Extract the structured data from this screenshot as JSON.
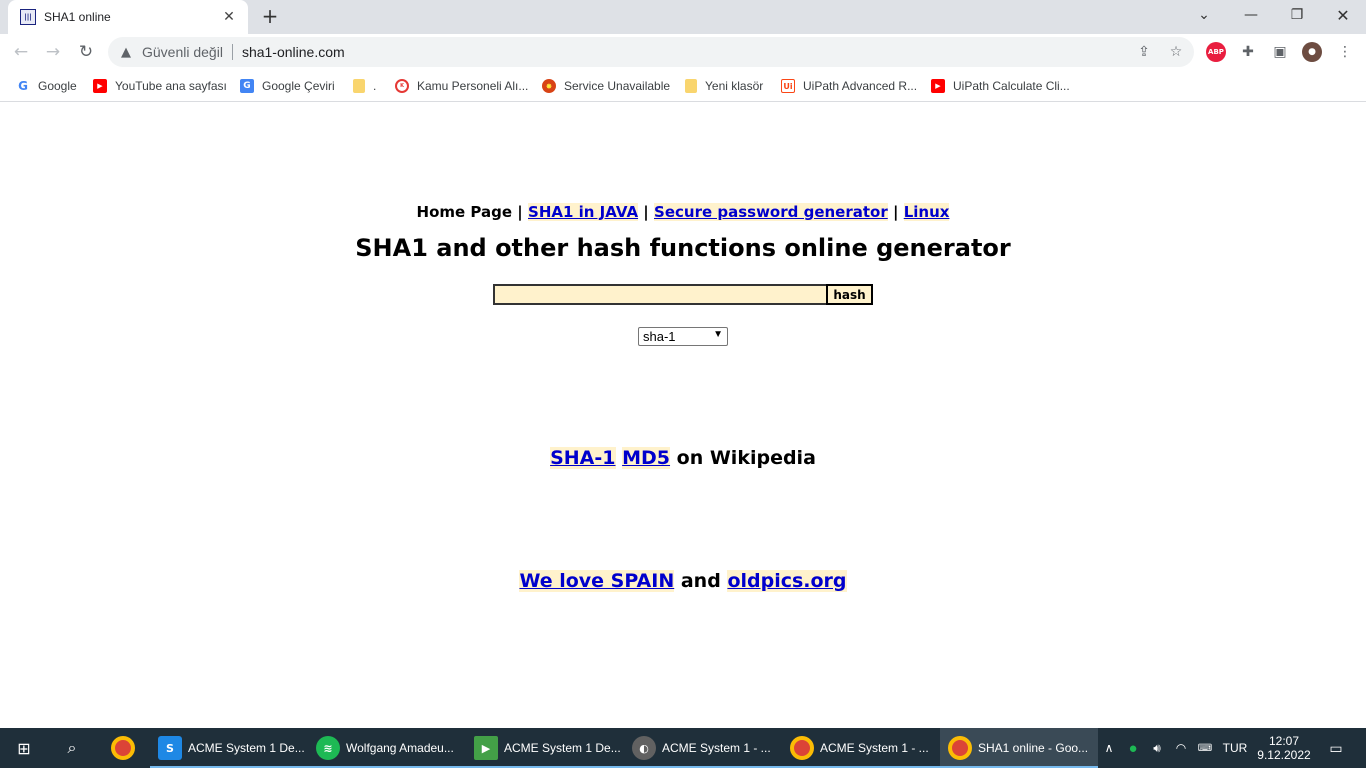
{
  "browser": {
    "tab_title": "SHA1 online",
    "security_label": "Güvenli değil",
    "url": "sha1-online.com"
  },
  "bookmarks": [
    {
      "label": "Google",
      "icon": "google-icon",
      "color": "#4285f4"
    },
    {
      "label": "YouTube ana sayfası",
      "icon": "youtube-icon",
      "color": "#ff0000"
    },
    {
      "label": "Google Çeviri",
      "icon": "translate-icon",
      "color": "#4285f4"
    },
    {
      "label": ".",
      "icon": "folder-icon",
      "color": "#f9d56e"
    },
    {
      "label": "Kamu Personeli Alı...",
      "icon": "kpss-icon",
      "color": "#e53935"
    },
    {
      "label": "Service Unavailable",
      "icon": "seal-icon",
      "color": "#d84315"
    },
    {
      "label": "Yeni klasör",
      "icon": "folder-icon",
      "color": "#f9d56e"
    },
    {
      "label": "UiPath Advanced R...",
      "icon": "uipath-icon",
      "color": "#fa4616"
    },
    {
      "label": "UiPath Calculate Cli...",
      "icon": "youtube-icon",
      "color": "#ff0000"
    }
  ],
  "page": {
    "nav_home": "Home Page",
    "nav_sep": "|",
    "nav_links": [
      "SHA1 in JAVA",
      "Secure password generator",
      "Linux"
    ],
    "heading": "SHA1 and other hash functions online generator",
    "input_value": "",
    "hash_button": "hash",
    "algorithm_selected": "sha-1",
    "wiki_links": [
      "SHA-1",
      "MD5"
    ],
    "wiki_suffix": "on Wikipedia",
    "spain_link": "We love SPAIN",
    "spain_and": "and",
    "oldpics_link": "oldpics.org",
    "link_bg": "#fff2cc",
    "link_color": "#0000cc"
  },
  "taskbar": {
    "apps": [
      {
        "label": "ACME System 1 De...",
        "icon": "acme-icon",
        "color": "#1e88e5"
      },
      {
        "label": "Wolfgang Amadeu...",
        "icon": "spotify-icon",
        "color": "#1db954"
      },
      {
        "label": "ACME System 1 De...",
        "icon": "play-icon",
        "color": "#43a047"
      },
      {
        "label": "ACME System 1 - ...",
        "icon": "globe-icon",
        "color": "#616161"
      },
      {
        "label": "ACME System 1 - ...",
        "icon": "chrome-icon",
        "color": "#db4437"
      },
      {
        "label": "SHA1 online - Goo...",
        "icon": "chrome-icon",
        "color": "#db4437"
      }
    ],
    "language": "TUR",
    "time": "12:07",
    "date": "9.12.2022"
  }
}
